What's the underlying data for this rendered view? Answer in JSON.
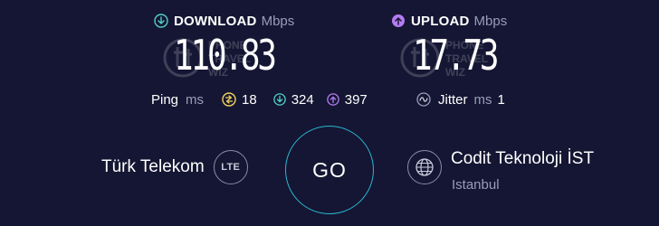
{
  "colors": {
    "background": "#151633",
    "download_accent": "#4fd1c5",
    "upload_accent": "#b47cf0",
    "ping_accent": "#f2d15c",
    "go_ring": "#29b6d3",
    "muted_text": "#9a9cb8"
  },
  "download": {
    "label": "DOWNLOAD",
    "unit": "Mbps",
    "value": "110.83",
    "icon": "download-arrow-icon"
  },
  "upload": {
    "label": "UPLOAD",
    "unit": "Mbps",
    "value": "17.73",
    "icon": "upload-arrow-icon"
  },
  "watermark": {
    "lines": [
      "PHONE",
      "TRAVEL",
      "WIZ"
    ]
  },
  "ping": {
    "label": "Ping",
    "unit": "ms",
    "idle": "18",
    "download": "324",
    "upload": "397"
  },
  "jitter": {
    "label": "Jitter",
    "unit": "ms",
    "value": "1"
  },
  "isp": {
    "name": "Türk Telekom",
    "connection": "LTE"
  },
  "go_button": {
    "label": "GO"
  },
  "server": {
    "name": "Codit Teknoloji İST",
    "location": "Istanbul"
  }
}
